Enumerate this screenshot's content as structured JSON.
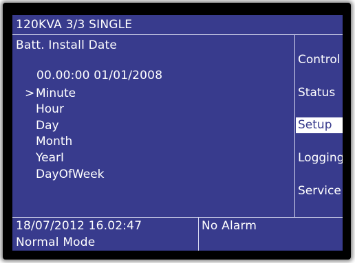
{
  "header": {
    "title": "120KVA   3/3 SINGLE"
  },
  "main": {
    "subtitle": "Batt. Install Date",
    "datetime_value": "00.00:00 01/01/2008",
    "cursor": ">",
    "items": [
      {
        "label": "Minute",
        "selected": true
      },
      {
        "label": "Hour",
        "selected": false
      },
      {
        "label": "Day",
        "selected": false
      },
      {
        "label": "Month",
        "selected": false
      },
      {
        "label": "YearI",
        "selected": false
      },
      {
        "label": "DayOfWeek",
        "selected": false
      }
    ]
  },
  "sidebar": {
    "items": [
      {
        "label": "Control",
        "active": false
      },
      {
        "label": "Status",
        "active": false
      },
      {
        "label": "Setup",
        "active": true
      },
      {
        "label": "Logging",
        "active": false
      },
      {
        "label": "Service",
        "active": false
      }
    ]
  },
  "statusbar": {
    "datetime": "18/07/2012  16.02:47",
    "mode": "Normal Mode",
    "alarm": "No Alarm"
  },
  "colors": {
    "screen_bg": "#383b8d",
    "text": "#ffffff",
    "highlight_bg": "#ffffff",
    "highlight_text": "#383b8d",
    "bezel": "#000000"
  }
}
